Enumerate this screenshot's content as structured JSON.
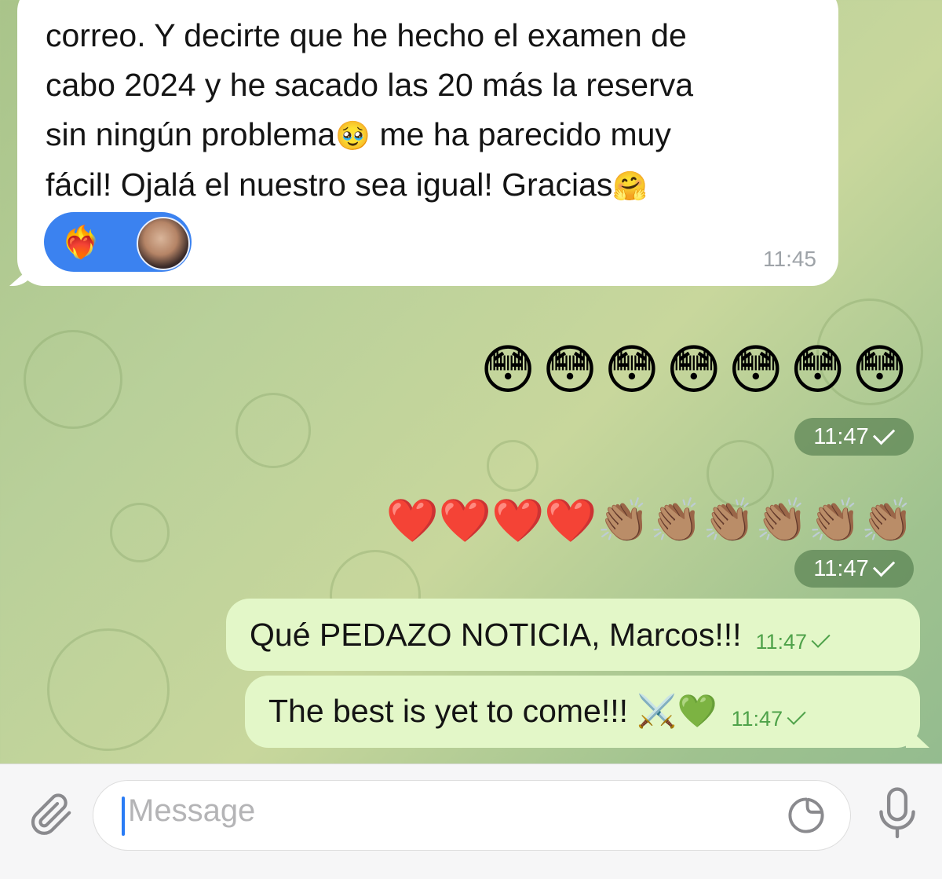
{
  "incoming": {
    "lines": [
      "correo. Y decirte que he hecho el examen de",
      "cabo 2024 y he sacado las 20 más la reserva",
      "sin ningún problema",
      " me ha parecido muy",
      "fácil! Ojalá el nuestro sea igual! Gracias"
    ],
    "emoji_pleading": "🥹",
    "emoji_hug": "🤗",
    "reaction_emoji": "❤️‍🔥",
    "time": "11:45"
  },
  "outgoing_emoji": [
    {
      "emojis": "😳😳😳😳😳😳😳",
      "time": "11:47"
    },
    {
      "emojis": "❤️❤️❤️❤️👏🏽👏🏽👏🏽👏🏽👏🏽👏🏽",
      "time": "11:47"
    }
  ],
  "outgoing_text": [
    {
      "text": "Qué PEDAZO NOTICIA, Marcos!!!",
      "time": "11:47"
    },
    {
      "text": "The best is yet to come!!! ⚔️💚",
      "time": "11:47"
    }
  ],
  "input": {
    "placeholder": "Message"
  },
  "icons": {
    "attach": "paperclip-icon",
    "sticker": "sticker-icon",
    "mic": "microphone-icon"
  },
  "colors": {
    "reaction_pill": "#3b82f0",
    "outgoing_bubble": "#e3f7c8",
    "check": "#4fa24a",
    "caret": "#2a7cf5"
  }
}
